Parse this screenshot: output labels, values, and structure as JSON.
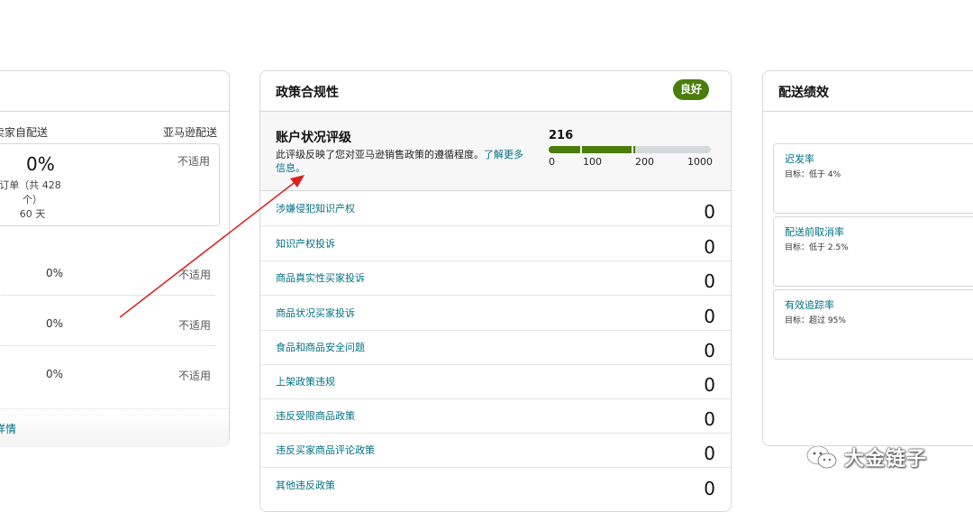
{
  "left_panel": {
    "columns": {
      "seller": "卖家自配送",
      "amazon": "亚马逊配送"
    },
    "summary": {
      "rate": "0%",
      "orders_line1": "订单（共 428",
      "orders_line2": "个）",
      "days": "60 天",
      "amazon_value": "不适用"
    },
    "rows": [
      {
        "seller": "0%",
        "amazon": "不适用"
      },
      {
        "seller": "0%",
        "amazon": "不适用"
      },
      {
        "seller": "0%",
        "amazon": "不适用"
      }
    ],
    "footer_link": "详情"
  },
  "policy_compliance": {
    "title": "政策合规性",
    "status_badge": "良好",
    "account_health": {
      "title": "账户状况评级",
      "description": "此评级反映了您对亚马逊销售政策的遵循程度。",
      "learn_more": "了解更多信息。",
      "score": "216",
      "score_value": 216,
      "scale_max": 1000,
      "ticks": [
        "0",
        "100",
        "200",
        "1000"
      ]
    },
    "rows": [
      {
        "label": "涉嫌侵犯知识产权",
        "value": "0"
      },
      {
        "label": "知识产权投诉",
        "value": "0"
      },
      {
        "label": "商品真实性买家投诉",
        "value": "0"
      },
      {
        "label": "商品状况买家投诉",
        "value": "0"
      },
      {
        "label": "食品和商品安全问题",
        "value": "0"
      },
      {
        "label": "上架政策违规",
        "value": "0"
      },
      {
        "label": "违反受限商品政策",
        "value": "0"
      },
      {
        "label": "违反买家商品评论政策",
        "value": "0"
      },
      {
        "label": "其他违反政策",
        "value": "0"
      }
    ]
  },
  "delivery_performance": {
    "title": "配送绩效",
    "metrics": [
      {
        "name": "迟发率",
        "target": "目标：低于 4%"
      },
      {
        "name": "配送前取消率",
        "target": "目标：低于 2.5%"
      },
      {
        "name": "有效追踪率",
        "target": "目标：超过 95%"
      }
    ]
  },
  "watermark": {
    "text": "大金链子"
  },
  "colors": {
    "good": "#4a7d0a",
    "link": "#007185",
    "arrow": "#e02020"
  }
}
